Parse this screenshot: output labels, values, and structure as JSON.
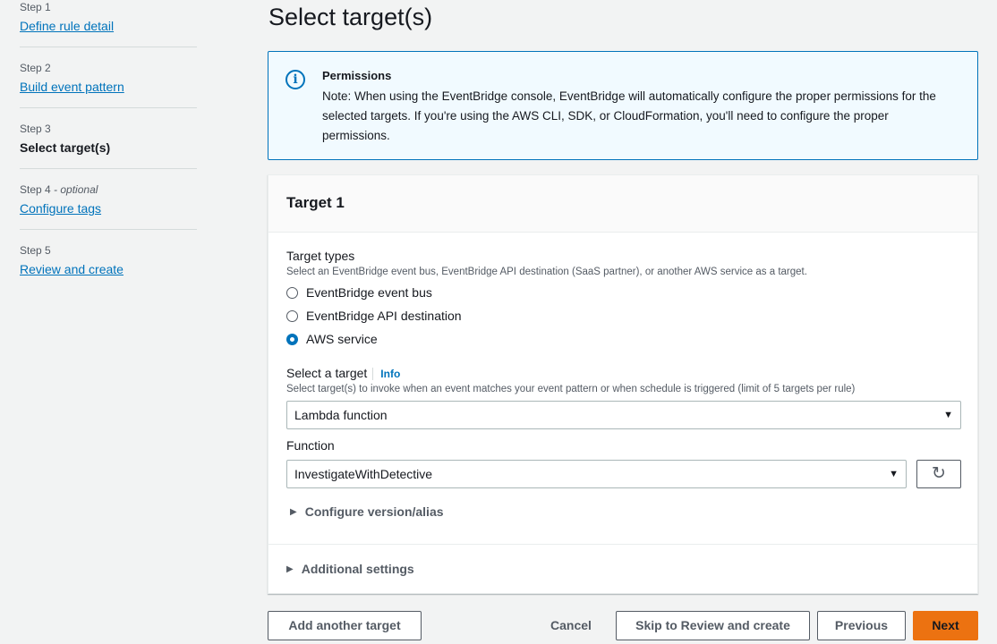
{
  "steps": [
    {
      "num": "Step 1",
      "label": "Define rule detail"
    },
    {
      "num": "Step 2",
      "label": "Build event pattern"
    },
    {
      "num": "Step 3",
      "label": "Select target(s)"
    },
    {
      "num": "Step 4",
      "optional": " - optional",
      "label": "Configure tags"
    },
    {
      "num": "Step 5",
      "label": "Review and create"
    }
  ],
  "page": {
    "title": "Select target(s)"
  },
  "alert": {
    "icon": "i",
    "title": "Permissions",
    "body": "Note: When using the EventBridge console, EventBridge will automatically configure the proper permissions for the selected targets. If you're using the AWS CLI, SDK, or CloudFormation, you'll need to configure the proper permissions."
  },
  "target": {
    "header": "Target 1",
    "types_label": "Target types",
    "types_desc": "Select an EventBridge event bus, EventBridge API destination (SaaS partner), or another AWS service as a target.",
    "options": [
      {
        "label": "EventBridge event bus",
        "checked": false
      },
      {
        "label": "EventBridge API destination",
        "checked": false
      },
      {
        "label": "AWS service",
        "checked": true
      }
    ],
    "select_label": "Select a target",
    "info": "Info",
    "select_desc": "Select target(s) to invoke when an event matches your event pattern or when schedule is triggered (limit of 5 targets per rule)",
    "select_value": "Lambda function",
    "function_label": "Function",
    "function_value": "InvestigateWithDetective",
    "refresh_glyph": "↻",
    "version_alias": "Configure version/alias",
    "additional": "Additional settings"
  },
  "footer": {
    "add_target": "Add another target",
    "cancel": "Cancel",
    "skip": "Skip to Review and create",
    "previous": "Previous",
    "next": "Next"
  },
  "colors": {
    "primary": "#ec7211",
    "link": "#0073bb",
    "alert_bg": "#f1faff"
  }
}
